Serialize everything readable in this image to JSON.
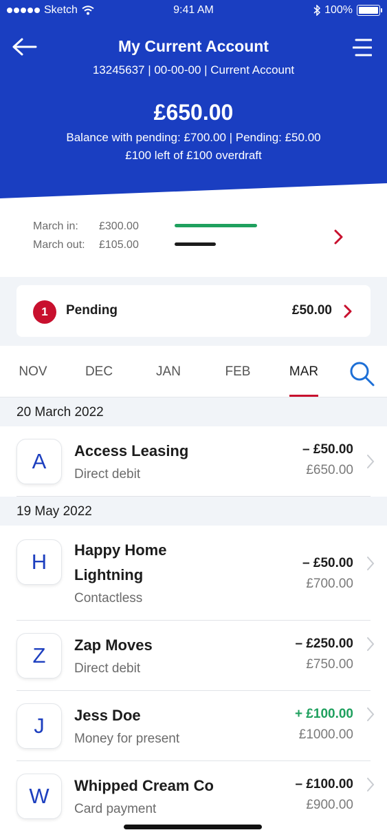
{
  "status_bar": {
    "carrier": "Sketch",
    "time": "9:41 AM",
    "battery": "100%"
  },
  "header": {
    "title": "My Current Account",
    "account_details": "13245637 | 00-00-00 | Current Account",
    "balance": "£650.00",
    "balance_details": "Balance with pending: £700.00 | Pending: £50.00",
    "overdraft": "£100 left of £100 overdraft",
    "bg_color": "#1a3ec1"
  },
  "summary": {
    "in_label": "March in:",
    "in_value": "£300.00",
    "out_label": "March out:",
    "out_value": "£105.00",
    "in_color": "#1fa05e",
    "out_color": "#1c1c1c"
  },
  "pending": {
    "count": "1",
    "label": "Pending",
    "amount": "£50.00"
  },
  "tabs": [
    {
      "label": "NOV"
    },
    {
      "label": "DEC"
    },
    {
      "label": "JAN"
    },
    {
      "label": "FEB"
    },
    {
      "label": "MAR",
      "active": true
    }
  ],
  "groups": [
    {
      "date": "20 March 2022",
      "transactions": [
        {
          "initial": "A",
          "name": "Access Leasing",
          "type": "Direct debit",
          "amount": "– £50.00",
          "balance": "£650.00"
        }
      ]
    },
    {
      "date": "19 May 2022",
      "transactions": [
        {
          "initial": "H",
          "name_line1": "Happy Home",
          "name_line2": "Lightning",
          "type": "Contactless",
          "amount": "– £50.00",
          "balance": "£700.00"
        },
        {
          "initial": "Z",
          "name": "Zap Moves",
          "type": "Direct debit",
          "amount": "– £250.00",
          "balance": "£750.00"
        },
        {
          "initial": "J",
          "name": "Jess Doe",
          "type": "Money for present",
          "amount": "+ £100.00",
          "balance": "£1000.00",
          "credit": true
        },
        {
          "initial": "W",
          "name": "Whipped Cream Co",
          "type": "Card payment",
          "amount": "– £100.00",
          "balance": "£900.00"
        }
      ]
    }
  ],
  "accent_red": "#c8102e"
}
